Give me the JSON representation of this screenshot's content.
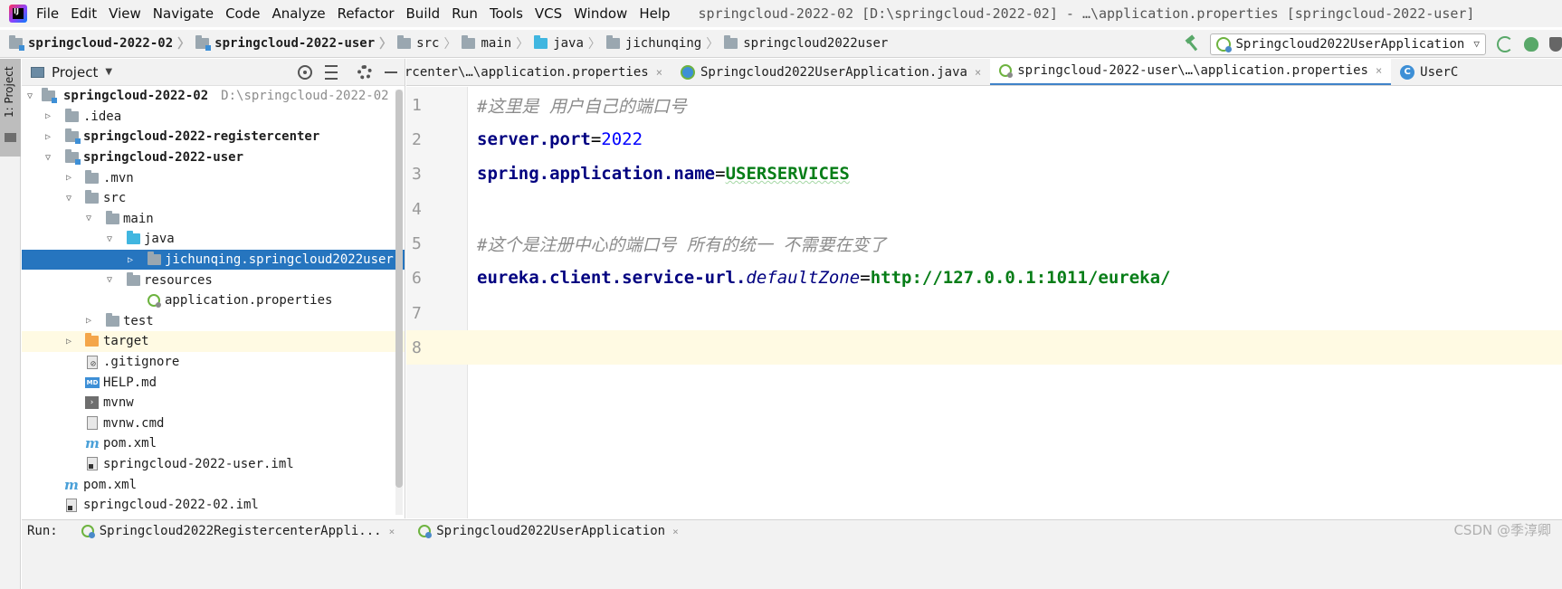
{
  "menu": {
    "logo_text": "IJ",
    "items": [
      "File",
      "Edit",
      "View",
      "Navigate",
      "Code",
      "Analyze",
      "Refactor",
      "Build",
      "Run",
      "Tools",
      "VCS",
      "Window",
      "Help"
    ],
    "window_title": "springcloud-2022-02 [D:\\springcloud-2022-02] - …\\application.properties [springcloud-2022-user]"
  },
  "breadcrumbs": [
    "springcloud-2022-02",
    "springcloud-2022-user",
    "src",
    "main",
    "java",
    "jichunqing",
    "springcloud2022user"
  ],
  "run_config": {
    "selected": "Springcloud2022UserApplication"
  },
  "tool_stripe": {
    "label": "1: Project"
  },
  "project_panel": {
    "title": "Project",
    "tree": [
      {
        "label": "springcloud-2022-02",
        "path": "D:\\springcloud-2022-02",
        "bold": true
      },
      {
        "label": ".idea"
      },
      {
        "label": "springcloud-2022-registercenter",
        "bold": true
      },
      {
        "label": "springcloud-2022-user",
        "bold": true
      },
      {
        "label": ".mvn"
      },
      {
        "label": "src"
      },
      {
        "label": "main"
      },
      {
        "label": "java"
      },
      {
        "label": "jichunqing.springcloud2022user",
        "selected": true
      },
      {
        "label": "resources"
      },
      {
        "label": "application.properties"
      },
      {
        "label": "test"
      },
      {
        "label": "target"
      },
      {
        "label": ".gitignore"
      },
      {
        "label": "HELP.md",
        "icon_text": "MD"
      },
      {
        "label": "mvnw"
      },
      {
        "label": "mvnw.cmd"
      },
      {
        "label": "pom.xml",
        "icon_text": "m"
      },
      {
        "label": "springcloud-2022-user.iml"
      },
      {
        "label": "pom.xml",
        "icon_text": "m"
      },
      {
        "label": "springcloud-2022-02.iml"
      }
    ]
  },
  "editor_tabs": [
    {
      "label": "rcenter\\…\\application.properties",
      "close": "×"
    },
    {
      "label": "Springcloud2022UserApplication.java",
      "close": "×"
    },
    {
      "label": "springcloud-2022-user\\…\\application.properties",
      "close": "×",
      "active": true
    },
    {
      "label": "UserC",
      "icon_text": "C"
    }
  ],
  "editor": {
    "lines": [
      {
        "num": "1",
        "comment": "#这里是 用户自己的端口号"
      },
      {
        "num": "2",
        "key": "server.port",
        "eq": "=",
        "value": "2022",
        "value_kind": "number"
      },
      {
        "num": "3",
        "key": "spring.application.name",
        "eq": "=",
        "value": "USERSERVICES",
        "value_kind": "string"
      },
      {
        "num": "4"
      },
      {
        "num": "5",
        "comment": "#这个是注册中心的端口号 所有的统一 不需要在变了"
      },
      {
        "num": "6",
        "key": "eureka.client.service-url.",
        "key_italic": "defaultZone",
        "eq": "=",
        "value": "http://127.0.0.1:1011/eureka/",
        "value_kind": "string"
      },
      {
        "num": "7"
      },
      {
        "num": "8"
      }
    ]
  },
  "run_bar": {
    "label": "Run:",
    "tabs": [
      "Springcloud2022RegistercenterAppli...",
      "Springcloud2022UserApplication"
    ],
    "tab_close": "×"
  },
  "watermark": "CSDN @季淳卿"
}
